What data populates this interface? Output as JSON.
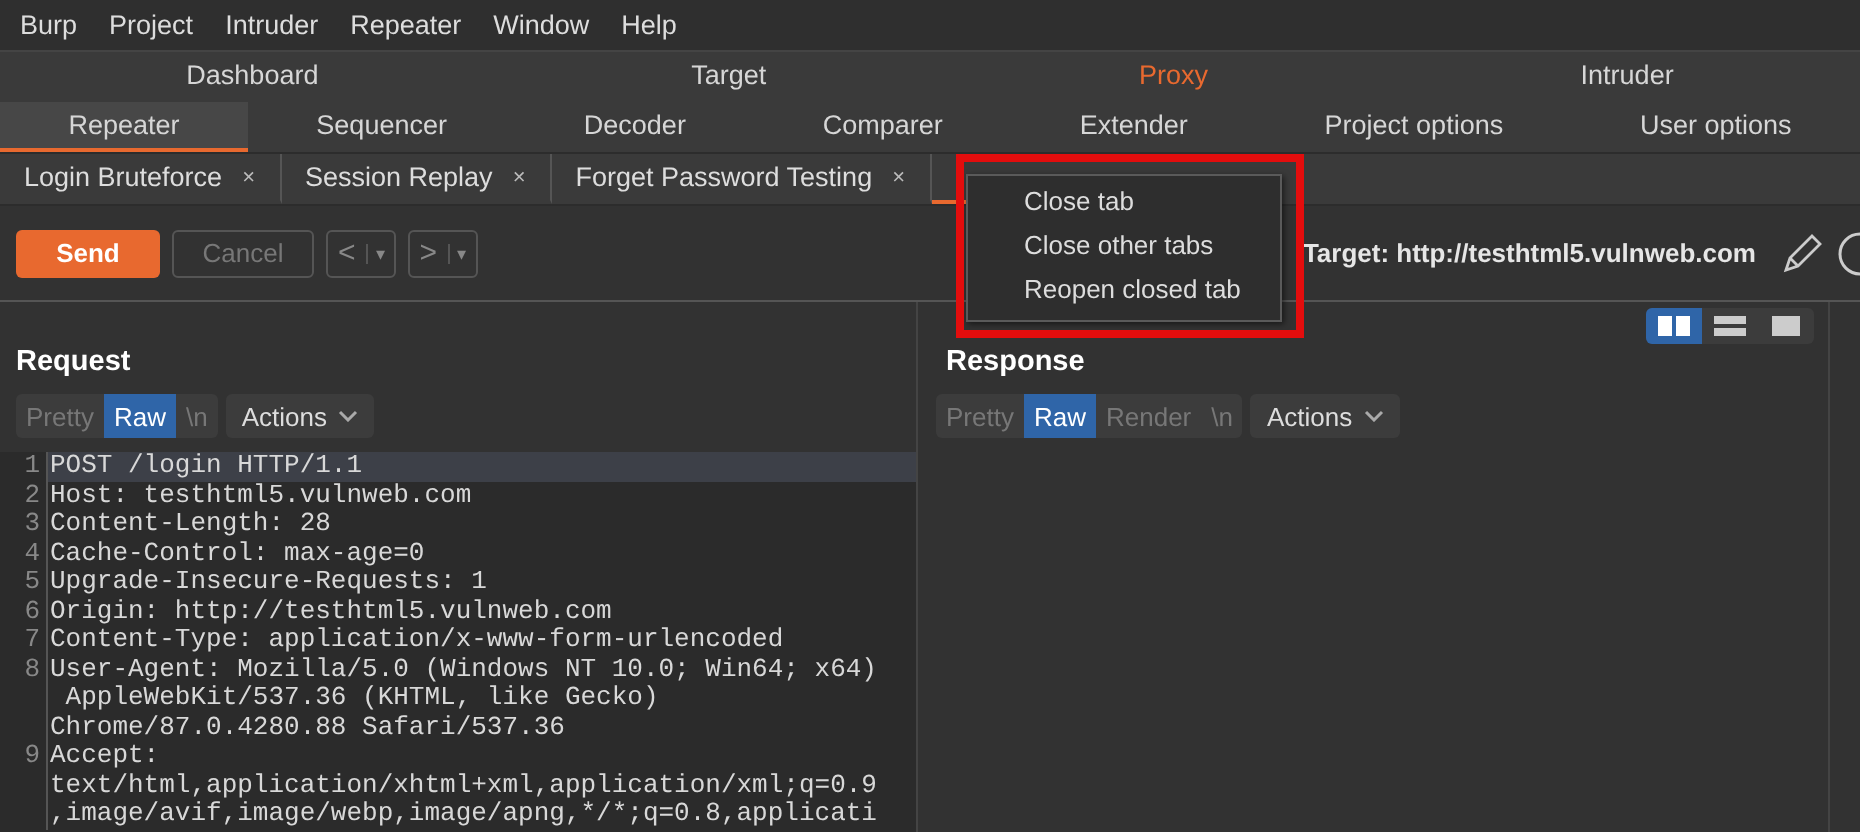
{
  "menu_bar": [
    "Burp",
    "Project",
    "Intruder",
    "Repeater",
    "Window",
    "Help"
  ],
  "main_tabs": [
    [
      {
        "label": "Dashboard",
        "selected": false,
        "highlighted": false
      },
      {
        "label": "Target",
        "selected": false,
        "highlighted": false
      },
      {
        "label": "Proxy",
        "selected": false,
        "highlighted": true
      },
      {
        "label": "Intruder",
        "selected": false,
        "highlighted": false
      }
    ],
    [
      {
        "label": "Repeater",
        "selected": true,
        "highlighted": false
      },
      {
        "label": "Sequencer",
        "selected": false,
        "highlighted": false
      },
      {
        "label": "Decoder",
        "selected": false,
        "highlighted": false
      },
      {
        "label": "Comparer",
        "selected": false,
        "highlighted": false
      },
      {
        "label": "Extender",
        "selected": false,
        "highlighted": false
      },
      {
        "label": "Project options",
        "selected": false,
        "highlighted": false
      },
      {
        "label": "User options",
        "selected": false,
        "highlighted": false
      }
    ]
  ],
  "repeater_tabs": [
    {
      "label": "Login Bruteforce",
      "close": "×",
      "selected": false
    },
    {
      "label": "Session Replay",
      "close": "×",
      "selected": false
    },
    {
      "label": "Forget Password Testing",
      "close": "×",
      "selected": false
    }
  ],
  "toolbar": {
    "send": "Send",
    "cancel": {
      "label": "Cancel",
      "disabled": true
    },
    "back": "<",
    "forward": ">",
    "dropdown": "▾",
    "target": "Target: http://testhtml5.vulnweb.com"
  },
  "layout_toggle": [
    {
      "kind": "columns",
      "selected": true
    },
    {
      "kind": "rows",
      "selected": false
    },
    {
      "kind": "single",
      "selected": false
    }
  ],
  "request": {
    "title": "Request",
    "views": [
      {
        "label": "Pretty",
        "selected": false
      },
      {
        "label": "Raw",
        "selected": true
      },
      {
        "label": "\\n",
        "selected": false
      }
    ],
    "actions": "Actions",
    "lines": [
      {
        "number": "1",
        "text": "POST /login HTTP/1.1",
        "current": true
      },
      {
        "number": "2",
        "text": "Host: testhtml5.vulnweb.com",
        "current": false
      },
      {
        "number": "3",
        "text": "Content-Length: 28",
        "current": false
      },
      {
        "number": "4",
        "text": "Cache-Control: max-age=0",
        "current": false
      },
      {
        "number": "5",
        "text": "Upgrade-Insecure-Requests: 1",
        "current": false
      },
      {
        "number": "6",
        "text": "Origin: http://testhtml5.vulnweb.com",
        "current": false
      },
      {
        "number": "7",
        "text": "Content-Type: application/x-www-form-urlencoded",
        "current": false
      },
      {
        "number": "8",
        "text": "User-Agent: Mozilla/5.0 (Windows NT 10.0; Win64; x64)",
        "current": false
      },
      {
        "text": " AppleWebKit/537.36 (KHTML, like Gecko)",
        "current": false
      },
      {
        "text": "Chrome/87.0.4280.88 Safari/537.36",
        "current": false
      },
      {
        "number": "9",
        "text": "Accept:",
        "current": false
      },
      {
        "text": "text/html,application/xhtml+xml,application/xml;q=0.9",
        "current": false
      },
      {
        "text": ",image/avif,image/webp,image/apng,*/*;q=0.8,applicati",
        "current": false
      }
    ]
  },
  "response": {
    "title": "Response",
    "views": [
      {
        "label": "Pretty",
        "selected": false
      },
      {
        "label": "Raw",
        "selected": true
      },
      {
        "label": "Render",
        "selected": false
      },
      {
        "label": "\\n",
        "selected": false
      }
    ],
    "actions": "Actions"
  },
  "context_menu": {
    "items": [
      "Close tab",
      "Close other tabs",
      "Reopen closed tab"
    ],
    "highlighted": true
  }
}
